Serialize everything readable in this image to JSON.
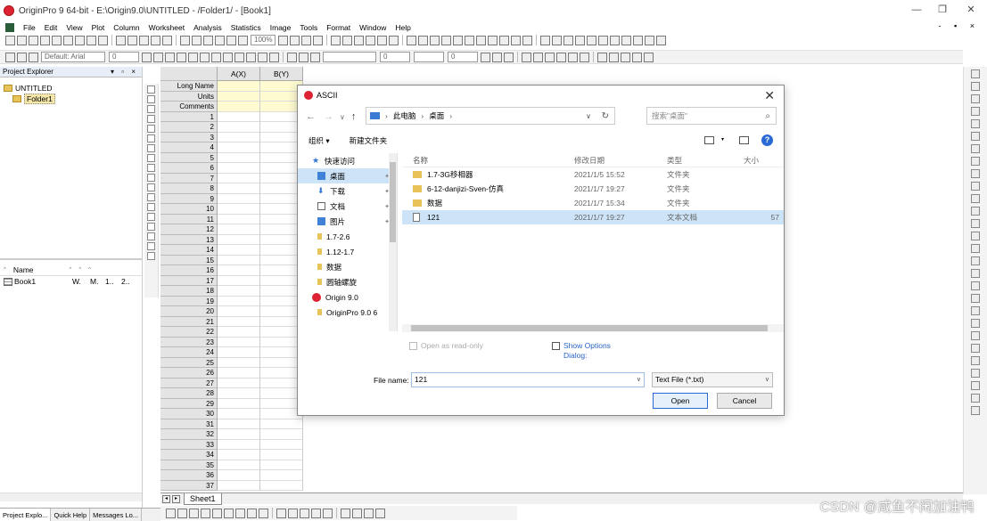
{
  "app": {
    "title": "OriginPro 9 64-bit - E:\\Origin9.0\\UNTITLED - /Folder1/ - [Book1]",
    "window_controls": [
      "—",
      "❐",
      "✕"
    ]
  },
  "menubar": {
    "items": [
      "File",
      "Edit",
      "View",
      "Plot",
      "Column",
      "Worksheet",
      "Analysis",
      "Statistics",
      "Image",
      "Tools",
      "Format",
      "Window",
      "Help"
    ],
    "right_controls": "- ▪ ×"
  },
  "toolbar": {
    "zoom": "100%",
    "font": "Default: Arial",
    "font_size": "0",
    "line_width": "0",
    "point_size": "0"
  },
  "project_explorer": {
    "title": "Project Explorer",
    "controls": "▾ ▫ ×",
    "tree": {
      "root": "UNTITLED",
      "child": "Folder1"
    },
    "list_headers": [
      "Name",
      "^",
      "^",
      "^",
      "^"
    ],
    "list_rows": [
      {
        "name": "Book1",
        "c1": "W.",
        "c2": "M.",
        "c3": "1..",
        "c4": "2.."
      }
    ],
    "tabs": [
      "Project Explo...",
      "Quick Help",
      "Messages Lo..."
    ]
  },
  "worksheet": {
    "columns": [
      "A(X)",
      "B(Y)"
    ],
    "meta_rows": [
      "Long Name",
      "Units",
      "Comments"
    ],
    "row_numbers": [
      "1",
      "2",
      "3",
      "4",
      "5",
      "6",
      "7",
      "8",
      "9",
      "10",
      "11",
      "12",
      "13",
      "14",
      "15",
      "16",
      "17",
      "18",
      "19",
      "20",
      "21",
      "22",
      "23",
      "24",
      "25",
      "26",
      "27",
      "28",
      "29",
      "30",
      "31",
      "32",
      "33",
      "34",
      "35",
      "36",
      "37"
    ],
    "sheet_tab": "Sheet1"
  },
  "dialog": {
    "title": "ASCII",
    "close": "✕",
    "nav": {
      "back": "←",
      "forward": "→",
      "up_menu": "∨",
      "up": "↑"
    },
    "path": [
      "此电脑",
      "桌面"
    ],
    "search_placeholder": "搜索\"桌面\"",
    "organize": "组织 ▾",
    "new_folder": "新建文件夹",
    "help": "?",
    "nav_pane": [
      {
        "label": "快速访问",
        "icon": "star-icon"
      },
      {
        "label": "桌面",
        "icon": "desktop-icon",
        "selected": true
      },
      {
        "label": "下载",
        "icon": "download-icon"
      },
      {
        "label": "文档",
        "icon": "document-icon"
      },
      {
        "label": "图片",
        "icon": "picture-icon"
      },
      {
        "label": "1.7-2.6",
        "icon": "folder-icon"
      },
      {
        "label": "1.12-1.7",
        "icon": "folder-icon"
      },
      {
        "label": "数据",
        "icon": "folder-icon"
      },
      {
        "label": "圆轴螺旋",
        "icon": "folder-icon"
      },
      {
        "label": "Origin 9.0",
        "icon": "origin-icon"
      },
      {
        "label": "OriginPro 9.0 6",
        "icon": "folder-icon"
      }
    ],
    "file_list": {
      "headers": {
        "name": "名称",
        "date": "修改日期",
        "type": "类型",
        "size": "大小"
      },
      "rows": [
        {
          "name": "1.7-3G移相器",
          "date": "2021/1/5 15:52",
          "type": "文件夹",
          "size": ""
        },
        {
          "name": "6-12-danjizi-Sven-仿真",
          "date": "2021/1/7 19:27",
          "type": "文件夹",
          "size": ""
        },
        {
          "name": "数据",
          "date": "2021/1/7 15:34",
          "type": "文件夹",
          "size": ""
        },
        {
          "name": "121",
          "date": "2021/1/7 19:27",
          "type": "文本文档",
          "size": "57",
          "selected": true
        }
      ]
    },
    "open_read_only": "Open as read-only",
    "show_options": "Show Options Dialog:",
    "file_name_label": "File name:",
    "file_name_value": "121",
    "file_type": "Text File (*.txt)",
    "open_button": "Open",
    "cancel_button": "Cancel"
  },
  "watermark": "CSDN @咸鱼不闲加油鸭"
}
